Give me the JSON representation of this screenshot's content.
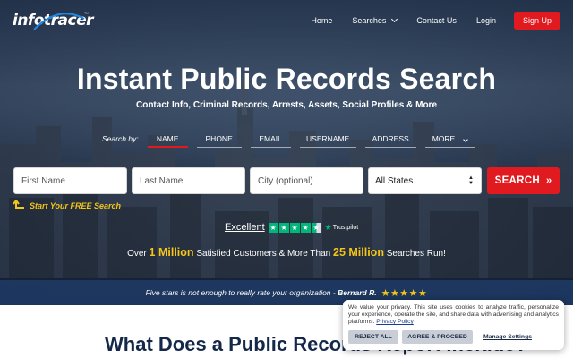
{
  "brand": {
    "logo_text": "infotracer",
    "logo_tm": "™"
  },
  "nav": {
    "home": "Home",
    "searches": "Searches",
    "contact": "Contact Us",
    "login": "Login",
    "signup": "Sign Up"
  },
  "hero": {
    "title": "Instant Public Records Search",
    "subtitle": "Contact Info, Criminal Records, Arrests, Assets, Social Profiles & More"
  },
  "search_by": {
    "label": "Search by:",
    "tabs": [
      {
        "label": "NAME",
        "active": true
      },
      {
        "label": "PHONE",
        "active": false
      },
      {
        "label": "EMAIL",
        "active": false
      },
      {
        "label": "USERNAME",
        "active": false
      },
      {
        "label": "ADDRESS",
        "active": false
      },
      {
        "label": "MORE",
        "active": false
      }
    ]
  },
  "form": {
    "first_name_placeholder": "First Name",
    "last_name_placeholder": "Last Name",
    "city_placeholder": "City (optional)",
    "state_selected": "All States",
    "search_label": "SEARCH",
    "search_arrows": "»",
    "free_search": "Start Your FREE Search"
  },
  "trustpilot": {
    "rating_label": "Excellent",
    "brand": "Trustpilot",
    "stars": 4.5
  },
  "stats": {
    "prefix": "Over",
    "customers_big": "1 Million",
    "middle": "Satisfied Customers & More Than",
    "searches_big": "25 Million",
    "suffix": "Searches Run!"
  },
  "testimonial": {
    "quote": "Five stars is not enough to really rate your organization -",
    "author": "Bernard R.",
    "stars": "★★★★★"
  },
  "section": {
    "heading": "What Does a Public Records Report Include?"
  },
  "cookie": {
    "text": "We value your privacy. This site uses cookies to analyze traffic, personalize your experience, operate the site, and share data with advertising and analytics platforms.",
    "policy_link": "Privacy Policy",
    "reject": "REJECT ALL",
    "accept": "AGREE & PROCEED",
    "manage": "Manage Settings"
  },
  "colors": {
    "accent_red": "#e11a1f",
    "gold": "#f5c518",
    "trustpilot_green": "#00b67a",
    "heading_navy": "#14284a"
  }
}
